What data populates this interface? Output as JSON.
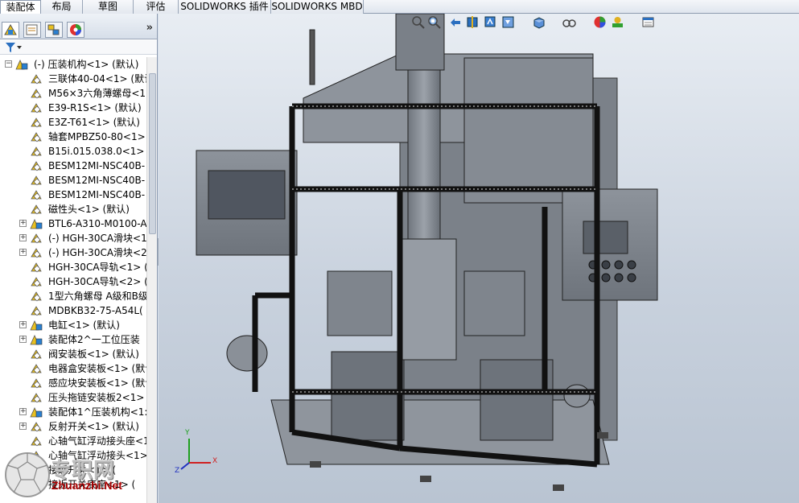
{
  "tabs": [
    {
      "label": "装配体",
      "active": true
    },
    {
      "label": "布局",
      "active": false
    },
    {
      "label": "草图",
      "active": false
    },
    {
      "label": "评估",
      "active": false
    },
    {
      "label": "SOLIDWORKS 插件",
      "active": false
    },
    {
      "label": "SOLIDWORKS MBD",
      "active": false
    }
  ],
  "panel": {
    "tab_icons": [
      "feature-manager-icon",
      "property-manager-icon",
      "configuration-manager-icon",
      "appearance-manager-icon"
    ],
    "collapse_label": "»",
    "filter_icon": "filter-icon"
  },
  "tree": {
    "root": "(-) 压装机构<1> (默认)",
    "items": [
      {
        "label": "三联体40-04<1> (默认",
        "icon": "part",
        "expandable": false
      },
      {
        "label": "M56×3六角薄螺母<1",
        "icon": "part",
        "expandable": false
      },
      {
        "label": "E39-R1S<1> (默认)",
        "icon": "part",
        "expandable": false
      },
      {
        "label": "E3Z-T61<1> (默认)",
        "icon": "part",
        "expandable": false
      },
      {
        "label": "轴套MPBZ50-80<1>",
        "icon": "part",
        "expandable": false
      },
      {
        "label": "B15i.015.038.0<1> (",
        "icon": "part",
        "expandable": false
      },
      {
        "label": "BESM12MI-NSC40B-",
        "icon": "part",
        "expandable": false
      },
      {
        "label": "BESM12MI-NSC40B-",
        "icon": "part",
        "expandable": false
      },
      {
        "label": "BESM12MI-NSC40B-",
        "icon": "part",
        "expandable": false
      },
      {
        "label": "磁性头<1> (默认)",
        "icon": "part",
        "expandable": false
      },
      {
        "label": "BTL6-A310-M0100-A",
        "icon": "assembly",
        "expandable": true
      },
      {
        "label": "(-) HGH-30CA滑块<1",
        "icon": "part",
        "expandable": true
      },
      {
        "label": "(-) HGH-30CA滑块<2",
        "icon": "part",
        "expandable": true
      },
      {
        "label": "HGH-30CA导轨<1> (",
        "icon": "part",
        "expandable": false
      },
      {
        "label": "HGH-30CA导轨<2> (",
        "icon": "part",
        "expandable": false
      },
      {
        "label": "1型六角螺母 A级和B级",
        "icon": "part",
        "expandable": false
      },
      {
        "label": "MDBKB32-75-A54L(",
        "icon": "part",
        "expandable": false
      },
      {
        "label": "电缸<1> (默认)",
        "icon": "assembly",
        "expandable": true
      },
      {
        "label": "装配体2^一工位压装",
        "icon": "assembly",
        "expandable": true
      },
      {
        "label": "阀安装板<1> (默认)",
        "icon": "part",
        "expandable": false
      },
      {
        "label": "电器盒安装板<1> (默认",
        "icon": "part",
        "expandable": false
      },
      {
        "label": "感应块安装板<1> (默认",
        "icon": "part",
        "expandable": false
      },
      {
        "label": "压头拖链安装板2<1>",
        "icon": "part",
        "expandable": false
      },
      {
        "label": "装配体1^压装机构<1:",
        "icon": "assembly",
        "expandable": true
      },
      {
        "label": "反射开关<1> (默认)",
        "icon": "part",
        "expandable": true
      },
      {
        "label": "心轴气缸浮动接头座<1",
        "icon": "part",
        "expandable": false
      },
      {
        "label": "心轴气缸浮动接头<1>",
        "icon": "part",
        "expandable": false
      },
      {
        "label": "接近开关<1> (",
        "icon": "part",
        "expandable": false
      },
      {
        "label": "接近开关底座<1> (",
        "icon": "part",
        "expandable": false
      }
    ]
  },
  "headsup_icons": [
    "zoom-to-fit-icon",
    "zoom-to-area-icon",
    "previous-view-icon",
    "section-view-icon",
    "dynamic-annotation-icon",
    "view-orientation-icon",
    "display-style-icon",
    "hide-show-items-icon",
    "edit-appearance-icon",
    "apply-scene-icon",
    "view-settings-icon"
  ],
  "triad": {
    "x_label": "X",
    "y_label": "Y",
    "z_label": "Z"
  },
  "watermark": {
    "brand": "专职网",
    "url": "Zhuanzhi.Net"
  },
  "colors": {
    "x_axis": "#d02020",
    "y_axis": "#20a020",
    "z_axis": "#2030c0",
    "frame": "#1a1a1a",
    "machine": "#8a8f96"
  }
}
